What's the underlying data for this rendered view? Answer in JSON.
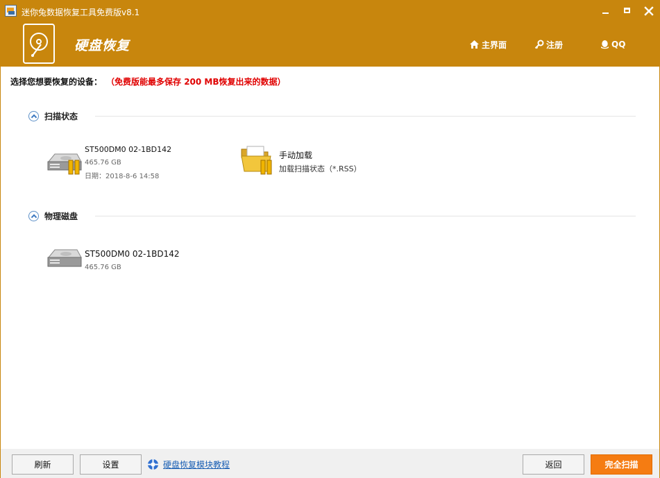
{
  "window": {
    "title": "迷你兔数据恢复工具免费版v8.1"
  },
  "header": {
    "title": "硬盘恢复",
    "nav": {
      "home": "主界面",
      "register": "注册",
      "qq": "QQ"
    }
  },
  "prompt": {
    "label": "选择您想要恢复的设备：",
    "warning": "（免费版能最多保存 200 MB恢复出来的数据）"
  },
  "sections": {
    "scan_status": {
      "title": "扫描状态",
      "items": [
        {
          "name": "ST500DM0 02-1BD142",
          "size": "465.76 GB",
          "date": "日期：2018-8-6 14:58"
        },
        {
          "name": "手动加载",
          "detail": "加载扫描状态（*.RSS）"
        }
      ]
    },
    "physical_disks": {
      "title": "物理磁盘",
      "items": [
        {
          "name": "ST500DM0 02-1BD142",
          "size": "465.76 GB"
        }
      ]
    }
  },
  "footer": {
    "refresh": "刷新",
    "settings": "设置",
    "help_link": "硬盘恢复模块教程",
    "back": "返回",
    "full_scan": "完全扫描"
  },
  "colors": {
    "brand": "#c8860d",
    "warning": "#e00000",
    "scan_button": "#f57c12",
    "link": "#1a5fb4"
  },
  "icons": {
    "app": "app-icon",
    "logo": "hard-disk-logo-icon",
    "home": "home-icon",
    "register": "key-icon",
    "qq": "qq-penguin-icon",
    "collapse": "chevron-up-circle-icon",
    "disk": "hard-drive-icon",
    "folder": "folder-icon",
    "help": "lifebuoy-icon"
  }
}
